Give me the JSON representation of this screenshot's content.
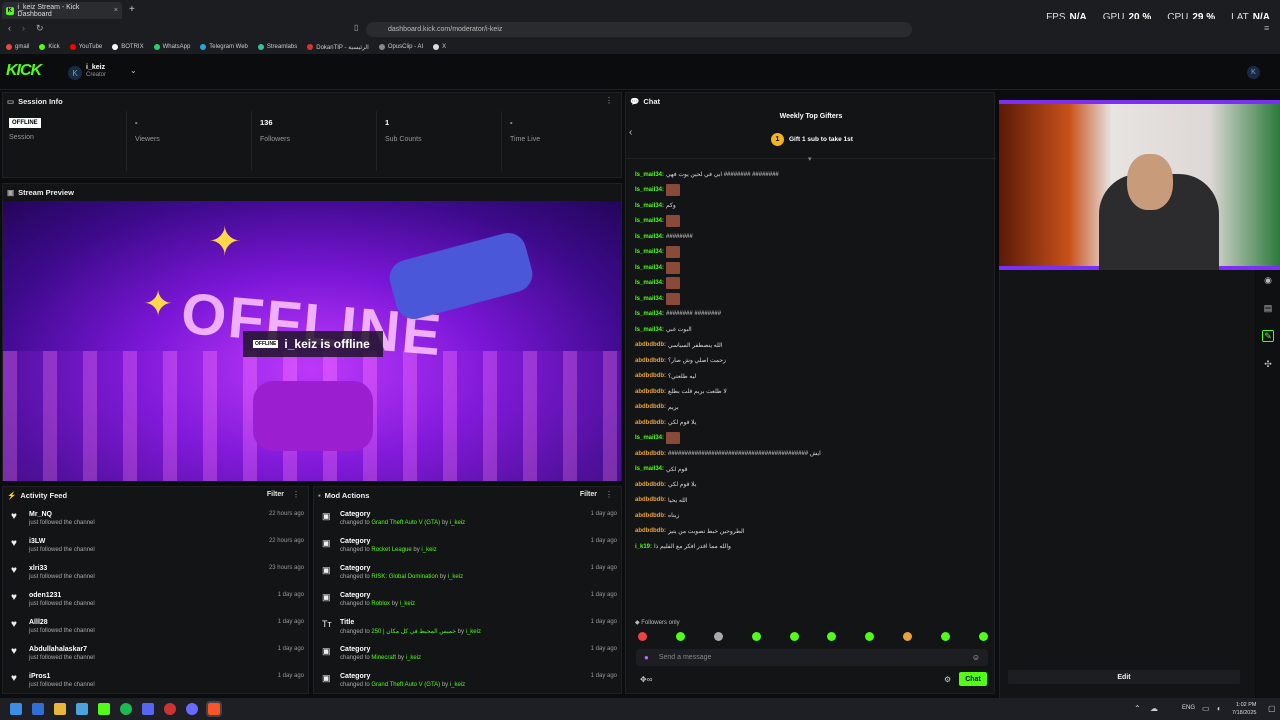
{
  "browser": {
    "tab_title": "i_keiz Stream - Kick Dashboard",
    "url": "dashboard.kick.com/moderator/i-keiz",
    "bookmarks": [
      "gmail",
      "Kick",
      "YouTube",
      "BOTRIX",
      "WhatsApp",
      "Telegram Web",
      "Streamlabs",
      "DokanTIP - الرئيسية",
      "OpusClip - AI",
      "X"
    ]
  },
  "perf_overlay": {
    "fps_label": "FPS",
    "fps": "N/A",
    "gpu_label": "GPU",
    "gpu": "20 %",
    "cpu_label": "CPU",
    "cpu": "29 %",
    "lat_label": "LAT",
    "lat": "N/A"
  },
  "header": {
    "logo": "KICK",
    "channel_initial": "K",
    "channel_name": "i_keiz",
    "role": "Creator"
  },
  "session": {
    "title": "Session Info",
    "status_badge": "OFFLINE",
    "stats": [
      {
        "value": "OFFLINE",
        "label": "Session"
      },
      {
        "value": "-",
        "label": "Viewers"
      },
      {
        "value": "136",
        "label": "Followers"
      },
      {
        "value": "1",
        "label": "Sub Counts"
      },
      {
        "value": "-",
        "label": "Time Live"
      }
    ]
  },
  "preview": {
    "title": "Stream Preview",
    "offline_badge": "OFFLINE",
    "offline_text": "i_keiz is offline",
    "art_text": "OFFLINE"
  },
  "activity": {
    "title": "Activity Feed",
    "filter": "Filter",
    "items": [
      {
        "name": "Mr_NQ",
        "sub": "just followed the channel",
        "time": "22 hours ago"
      },
      {
        "name": "i3LW",
        "sub": "just followed the channel",
        "time": "22 hours ago"
      },
      {
        "name": "xlri33",
        "sub": "just followed the channel",
        "time": "23 hours ago"
      },
      {
        "name": "oden1231",
        "sub": "just followed the channel",
        "time": "1 day ago"
      },
      {
        "name": "Alll28",
        "sub": "just followed the channel",
        "time": "1 day ago"
      },
      {
        "name": "Abdullahalaskar7",
        "sub": "just followed the channel",
        "time": "1 day ago"
      },
      {
        "name": "iPros1",
        "sub": "just followed the channel",
        "time": "1 day ago"
      }
    ]
  },
  "mod": {
    "title": "Mod Actions",
    "filter": "Filter",
    "items": [
      {
        "type": "Category",
        "pre": "changed to ",
        "val": "Grand Theft Auto V (GTA)",
        "by": " by ",
        "user": "i_keiz",
        "time": "1 day ago"
      },
      {
        "type": "Category",
        "pre": "changed to ",
        "val": "Rocket League",
        "by": " by ",
        "user": "i_keiz",
        "time": "1 day ago"
      },
      {
        "type": "Category",
        "pre": "changed to ",
        "val": "RISK: Global Domination",
        "by": " by ",
        "user": "i_keiz",
        "time": "1 day ago"
      },
      {
        "type": "Category",
        "pre": "changed to ",
        "val": "Roblox",
        "by": " by ",
        "user": "i_keiz",
        "time": "1 day ago"
      },
      {
        "type": "Title",
        "pre": "changed to ",
        "val": "250 | خميس المحيط في كل مكان",
        "by": " by ",
        "user": "i_keiz",
        "time": "1 day ago"
      },
      {
        "type": "Category",
        "pre": "changed to ",
        "val": "Minecraft",
        "by": " by ",
        "user": "i_keiz",
        "time": "1 day ago"
      },
      {
        "type": "Category",
        "pre": "changed to ",
        "val": "Grand Theft Auto V (GTA)",
        "by": " by ",
        "user": "i_keiz",
        "time": "1 day ago"
      }
    ]
  },
  "chat": {
    "title": "Chat",
    "top_gifters": "Weekly Top Gifters",
    "gift_rank": "1",
    "gift_text": "Gift 1 sub to take 1st",
    "messages": [
      {
        "user": "Is_mail34:",
        "cls": "u-green",
        "text": "ابي في لحين يوت فهي ######## ########",
        "emote": false
      },
      {
        "user": "Is_mail34:",
        "cls": "u-green",
        "text": "",
        "emote": true
      },
      {
        "user": "Is_mail34:",
        "cls": "u-green",
        "text": "وكم",
        "emote": false
      },
      {
        "user": "Is_mail34:",
        "cls": "u-green",
        "text": "",
        "emote": true
      },
      {
        "user": "Is_mail34:",
        "cls": "u-green",
        "text": "########",
        "emote": false
      },
      {
        "user": "Is_mail34:",
        "cls": "u-green",
        "text": "",
        "emote": true
      },
      {
        "user": "Is_mail34:",
        "cls": "u-green",
        "text": "",
        "emote": true
      },
      {
        "user": "Is_mail34:",
        "cls": "u-green",
        "text": "",
        "emote": true
      },
      {
        "user": "Is_mail34:",
        "cls": "u-green",
        "text": "",
        "emote": true
      },
      {
        "user": "Is_mail34:",
        "cls": "u-green",
        "text": "######## ########",
        "emote": false
      },
      {
        "user": "Is_mail34:",
        "cls": "u-green",
        "text": "البوت غبي",
        "emote": false
      },
      {
        "user": "abdbdbdb:",
        "cls": "u-orange",
        "text": "الله ينصطفر السياسي",
        "emote": false
      },
      {
        "user": "abdbdbdb:",
        "cls": "u-orange",
        "text": "زحمت اصلي وش صار؟",
        "emote": false
      },
      {
        "user": "abdbdbdb:",
        "cls": "u-orange",
        "text": "ليه طلعتي؟",
        "emote": false
      },
      {
        "user": "abdbdbdb:",
        "cls": "u-orange",
        "text": "لا طلعت بريم قلت بطلع",
        "emote": false
      },
      {
        "user": "abdbdbdb:",
        "cls": "u-orange",
        "text": "بريم",
        "emote": false
      },
      {
        "user": "abdbdbdb:",
        "cls": "u-orange",
        "text": "يلا قوم لكي",
        "emote": false
      },
      {
        "user": "Is_mail34:",
        "cls": "u-green",
        "text": "",
        "emote": true
      },
      {
        "user": "abdbdbdb:",
        "cls": "u-orange",
        "text": "########################################## ايش",
        "emote": false
      },
      {
        "user": "Is_mail34:",
        "cls": "u-green",
        "text": "قوم لكي",
        "emote": false
      },
      {
        "user": "abdbdbdb:",
        "cls": "u-orange",
        "text": "يلا قوم لكي",
        "emote": false
      },
      {
        "user": "abdbdbdb:",
        "cls": "u-orange",
        "text": "الله يحيا",
        "emote": false
      },
      {
        "user": "abdbdbdb:",
        "cls": "u-orange",
        "text": "زيناه",
        "emote": false
      },
      {
        "user": "abdbdbdb:",
        "cls": "u-orange",
        "text": "الطروحين خبط تصوبت من يتيز",
        "emote": false
      },
      {
        "user": "i_k19:",
        "cls": "u-green",
        "text": "والله مما اقدر افكر مع الفليم ذا",
        "emote": false
      }
    ],
    "followers_only": "Followers only",
    "placeholder": "Send a message",
    "send": "Chat"
  },
  "right": {
    "edit": "Edit"
  },
  "taskbar": {
    "lang": "ENG",
    "time": "1:02 PM",
    "date": "7/18/2025"
  },
  "colors": {
    "accent": "#53fc18",
    "offline_bg": "#ffffff"
  }
}
